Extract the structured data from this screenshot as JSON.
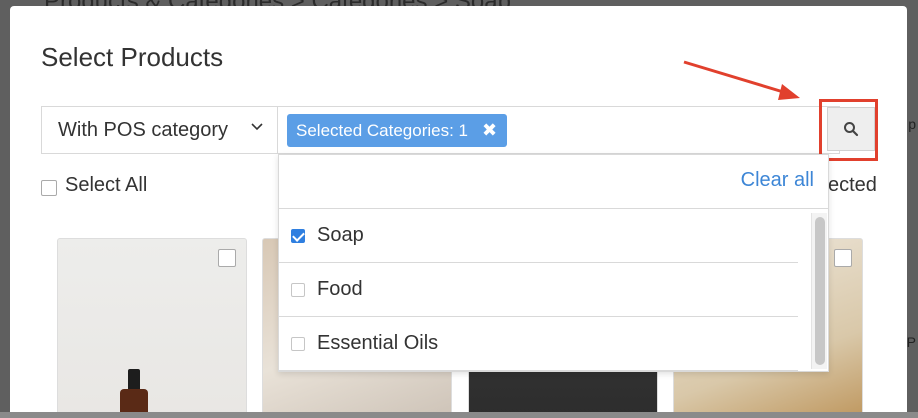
{
  "background": {
    "breadcrumb": "Products & Categories > Categories > Soap",
    "right_text_1": "p",
    "right_text_2": "P"
  },
  "modal": {
    "title": "Select Products",
    "filter": {
      "category_mode": "With POS category",
      "tag_label": "Selected Categories: 1",
      "search_icon": "search-icon"
    },
    "select_all_label": "Select All",
    "selected_count_text": "ected",
    "dropdown": {
      "clear_all": "Clear all",
      "items": [
        {
          "label": "Soap",
          "checked": true
        },
        {
          "label": "Food",
          "checked": false
        },
        {
          "label": "Essential Oils",
          "checked": false
        }
      ]
    }
  },
  "colors": {
    "accent": "#5b9ee6",
    "link": "#3d86d6",
    "annotation": "#e1402d"
  }
}
